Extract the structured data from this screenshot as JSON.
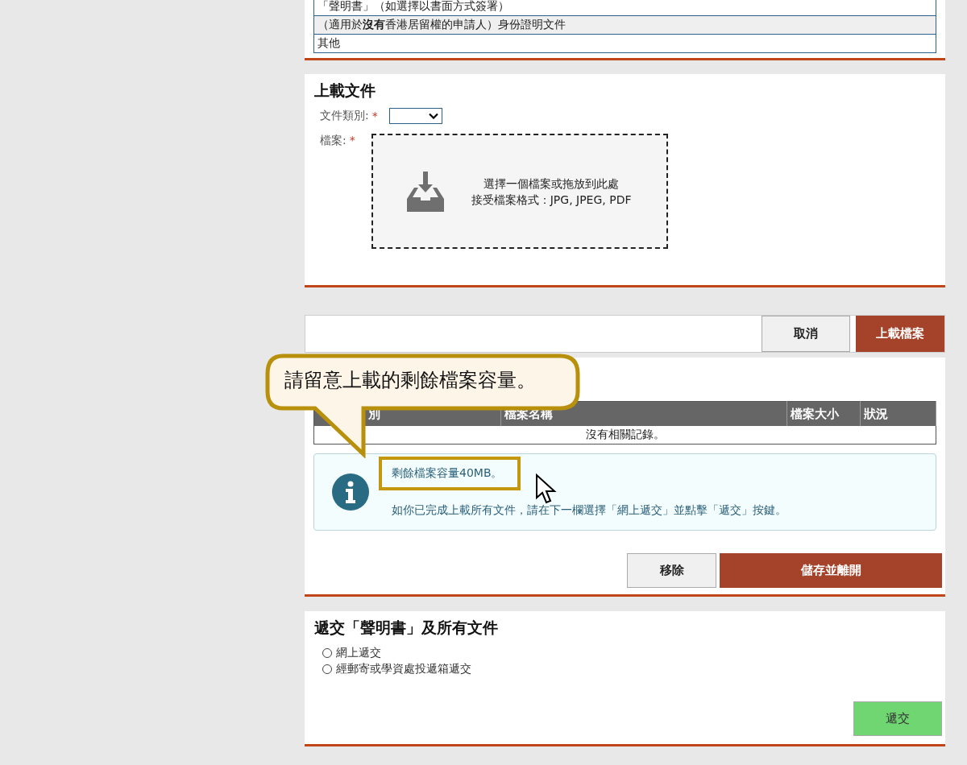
{
  "document_list": {
    "rows": [
      "「聲明書」（如選擇以書面方式簽署）",
      "（適用於**沒有**香港居留權的申請人）身份證明文件",
      "其他"
    ]
  },
  "upload": {
    "title": "上載文件",
    "type_label": "文件類別:",
    "file_label": "檔案:",
    "required_mark": "*",
    "drop_line_1": "選擇一個檔案或拖放到此處",
    "drop_line_2": "接受檔案格式：JPG, JPEG, PDF"
  },
  "upload_buttons": [
    "取消",
    "上載檔案"
  ],
  "callout": {
    "text": "請留意上載的剩餘檔案容量。"
  },
  "file_table": {
    "columns": [
      "別",
      "檔案名稱",
      "檔案大小",
      "狀況"
    ],
    "empty_text": "沒有相關記錄。"
  },
  "info": {
    "remaining": "剩餘檔案容量40MB。",
    "message": "如你已完成上載所有文件，請在下一欄選擇「網上遞交」並點擊「遞交」按鍵。"
  },
  "file_buttons": [
    "移除",
    "儲存並離開"
  ],
  "submit": {
    "title": "遞交「聲明書」及所有文件",
    "options": [
      {
        "label": "網上遞交",
        "selected": false
      },
      {
        "label": "經郵寄或學資處投遞箱遞交",
        "selected": false
      }
    ],
    "button": "遞交"
  }
}
